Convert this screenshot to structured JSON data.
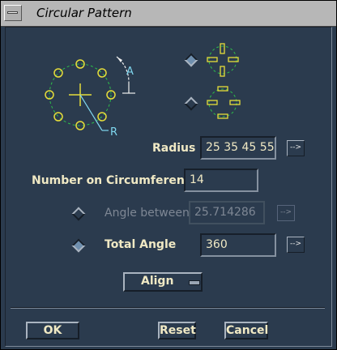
{
  "window": {
    "title": "Circular Pattern",
    "menu_icon": "window-menu-icon"
  },
  "form": {
    "radius": {
      "label": "Radius",
      "value": "25 35 45 55",
      "arrow": "-->"
    },
    "number": {
      "label": "Number on Circumference",
      "value": "14"
    },
    "angle_between": {
      "label": "Angle between",
      "value": "25.714286",
      "arrow": "-->",
      "enabled": false
    },
    "total_angle": {
      "label": "Total Angle",
      "value": "360",
      "arrow": "-->",
      "selected": true
    },
    "align": {
      "label": "Align"
    }
  },
  "diagram": {
    "angle_label": "A",
    "radius_label": "R"
  },
  "orientation_options": [
    {
      "name": "orientation-radial",
      "selected": true
    },
    {
      "name": "orientation-fixed",
      "selected": false
    }
  ],
  "buttons": {
    "ok": "OK",
    "reset": "Reset",
    "cancel": "Cancel"
  },
  "colors": {
    "background": "#2b3b4e",
    "text": "#f0e9c4",
    "diagram_yellow": "#e6dd3a",
    "diagram_green": "#2dbf4a",
    "diagram_cyan": "#7fd6ee"
  }
}
